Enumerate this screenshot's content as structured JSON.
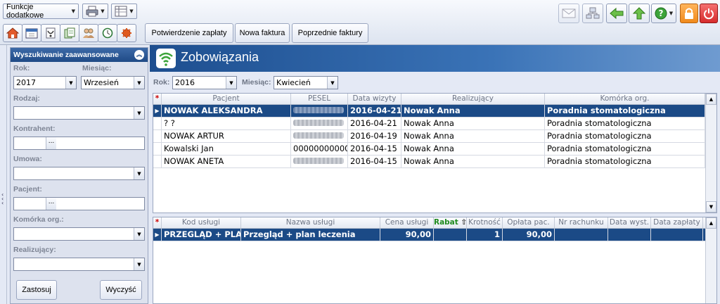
{
  "toolbar": {
    "functions_label": "Funkcje dodatkowe",
    "tabs": [
      "Potwierdzenie zapłaty",
      "Nowa faktura",
      "Poprzednie faktury"
    ]
  },
  "colors": {
    "accent": "#1b4a86",
    "header_gradient_start": "#1d4e8f",
    "panel_bg": "#dde2ee",
    "rabat_green": "#1e8a1e"
  },
  "search_panel": {
    "title": "Wyszukiwanie zaawansowane",
    "rok_label": "Rok:",
    "rok_value": "2017",
    "miesiac_label": "Miesiąc:",
    "miesiac_value": "Wrzesień",
    "rodzaj_label": "Rodzaj:",
    "rodzaj_value": "",
    "kontrahent_label": "Kontrahent:",
    "kontrahent_value": "",
    "umowa_label": "Umowa:",
    "umowa_value": "",
    "pacjent_label": "Pacjent:",
    "pacjent_value": "",
    "komorka_label": "Komórka org.:",
    "komorka_value": "",
    "realizujacy_label": "Realizujący:",
    "realizujacy_value": "",
    "apply_label": "Zastosuj",
    "clear_label": "Wyczyść",
    "ellipsis": "..."
  },
  "main": {
    "title": "Zobowiązania",
    "rok_label": "Rok:",
    "rok_value": "2016",
    "miesiac_label": "Miesiąc:",
    "miesiac_value": "Kwiecień"
  },
  "visits": {
    "columns": [
      "Pacjent",
      "PESEL",
      "Data wizyty",
      "Realizujący",
      "Komórka org."
    ],
    "rows": [
      {
        "pacjent": "NOWAK ALEKSANDRA",
        "pesel": "",
        "data": "2016-04-21",
        "realizujacy": "Nowak Anna",
        "komorka": "Poradnia stomatologiczna"
      },
      {
        "pacjent": "? ?",
        "pesel": "",
        "data": "2016-04-21",
        "realizujacy": "Nowak Anna",
        "komorka": "Poradnia stomatologiczna"
      },
      {
        "pacjent": "NOWAK ARTUR",
        "pesel": "",
        "data": "2016-04-19",
        "realizujacy": "Nowak Anna",
        "komorka": "Poradnia stomatologiczna"
      },
      {
        "pacjent": "Kowalski Jan",
        "pesel": "00000000000",
        "data": "2016-04-15",
        "realizujacy": "Nowak Anna",
        "komorka": "Poradnia stomatologiczna"
      },
      {
        "pacjent": "NOWAK ANETA",
        "pesel": "",
        "data": "2016-04-15",
        "realizujacy": "Nowak Anna",
        "komorka": "Poradnia stomatologiczna"
      }
    ]
  },
  "services": {
    "columns": [
      "Kod usługi",
      "Nazwa usługi",
      "Cena usługi",
      "Rabat",
      "Krotność",
      "Opłata pac.",
      "Nr rachunku",
      "Data wyst.",
      "Data zapłaty"
    ],
    "rows": [
      {
        "kod": "PRZEGLĄD + PLAN",
        "nazwa": "Przegląd + plan leczenia",
        "cena": "90,00",
        "rabat": "",
        "krotnosc": "1",
        "oplata": "90,00",
        "nr": "",
        "data_wyst": "",
        "data_zaplaty": ""
      }
    ]
  }
}
